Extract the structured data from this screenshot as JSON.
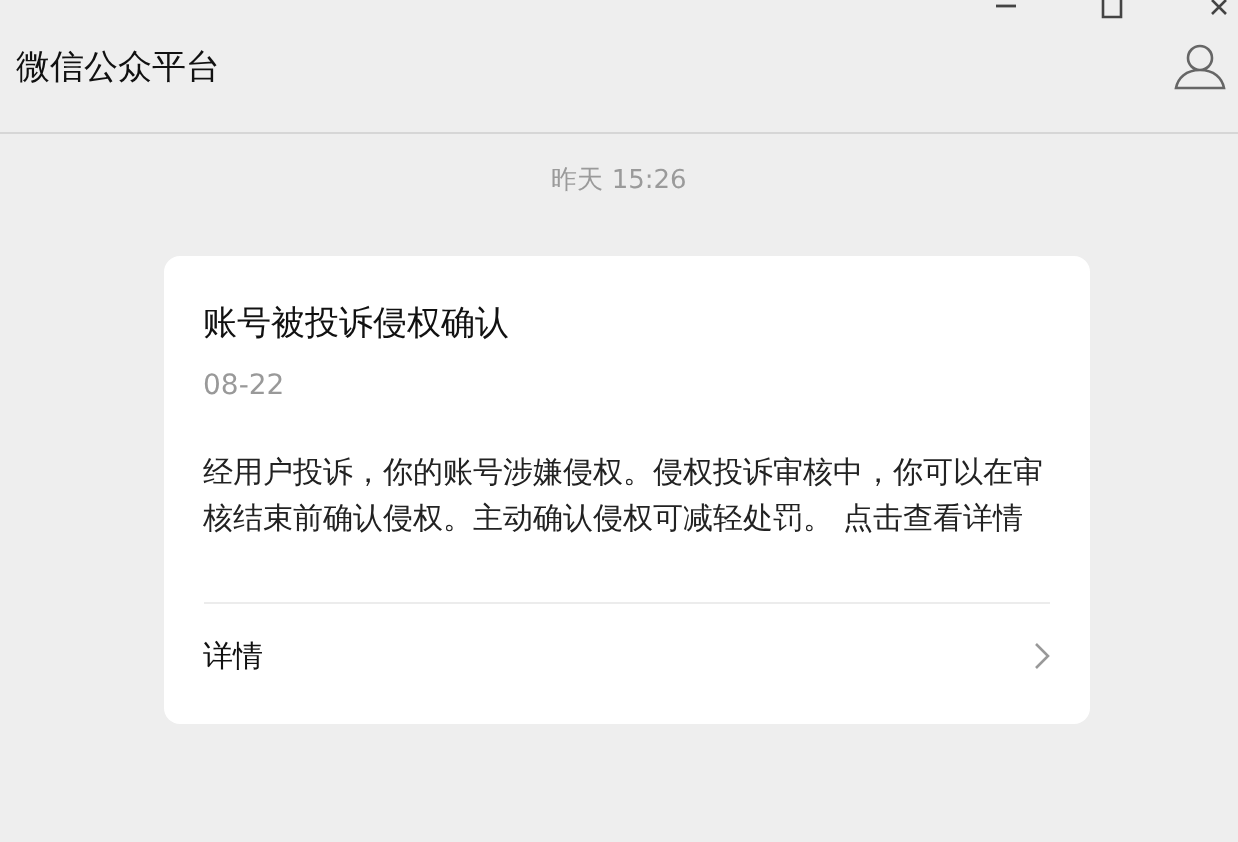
{
  "window": {
    "title": "微信公众平台"
  },
  "timestamp": "昨天 15:26",
  "message": {
    "title": "账号被投诉侵权确认",
    "date": "08-22",
    "body": "经用户投诉，你的账号涉嫌侵权。侵权投诉审核中，你可以在审核结束前确认侵权。主动确认侵权可减轻处罚。 点击查看详情",
    "link": "详情"
  }
}
